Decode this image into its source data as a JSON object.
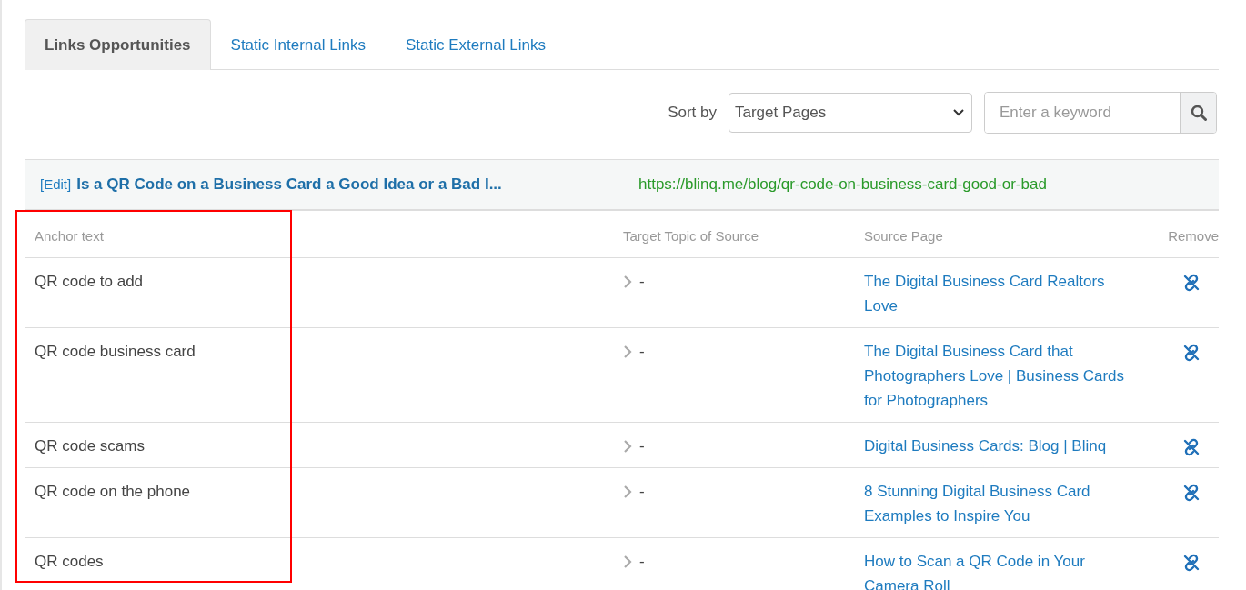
{
  "tabs": [
    {
      "label": "Links Opportunities",
      "selected": true
    },
    {
      "label": "Static Internal Links",
      "selected": false
    },
    {
      "label": "Static External Links",
      "selected": false
    }
  ],
  "toolbar": {
    "sort_label": "Sort by",
    "sort_value": "Target Pages",
    "search_placeholder": "Enter a keyword"
  },
  "target": {
    "edit_link": "[Edit]",
    "title": "Is a QR Code on a Business Card a Good Idea or a Bad I...",
    "url": "https://blinq.me/blog/qr-code-on-business-card-good-or-bad"
  },
  "table": {
    "columns": [
      {
        "label": "Anchor text",
        "highlighted": true
      },
      {
        "label": "Target Topic of Source",
        "highlighted": false
      },
      {
        "label": "Source Page",
        "highlighted": false
      },
      {
        "label": "Remove",
        "highlighted": false
      }
    ],
    "rows": [
      {
        "anchor": "QR code to add",
        "topic": "-",
        "source": "The Digital Business Card Realtors Love"
      },
      {
        "anchor": "QR code business card",
        "topic": "-",
        "source": "The Digital Business Card that Photographers Love | Business Cards for Photographers"
      },
      {
        "anchor": "QR code scams",
        "topic": "-",
        "source": "Digital Business Cards: Blog | Blinq"
      },
      {
        "anchor": "QR code on the phone",
        "topic": "-",
        "source": "8 Stunning Digital Business Card Examples to Inspire You"
      },
      {
        "anchor": "QR codes",
        "topic": "-",
        "source": "How to Scan a QR Code in Your Camera Roll"
      }
    ]
  }
}
